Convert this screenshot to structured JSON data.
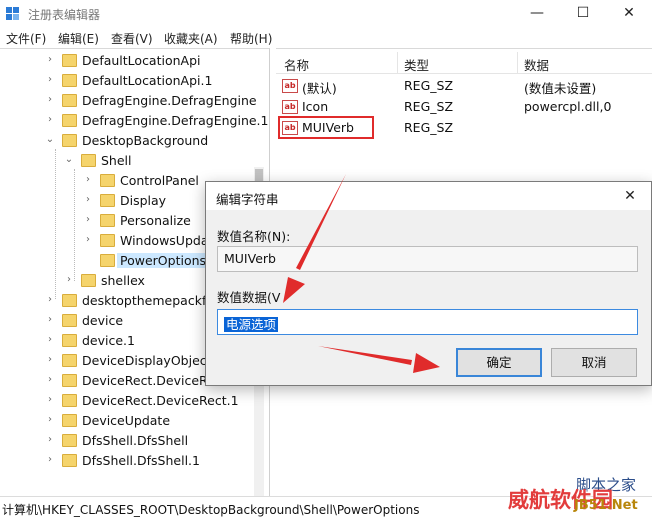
{
  "window": {
    "title": "注册表编辑器",
    "controls": {
      "minimize": "—",
      "maximize": "☐",
      "close": "✕"
    }
  },
  "menu": [
    "文件(F)",
    "编辑(E)",
    "查看(V)",
    "收藏夹(A)",
    "帮助(H)"
  ],
  "tree": {
    "items": [
      {
        "label": "DefaultLocationApi",
        "expander": "›"
      },
      {
        "label": "DefaultLocationApi.1",
        "expander": "›"
      },
      {
        "label": "DefragEngine.DefragEngine",
        "expander": "›"
      },
      {
        "label": "DefragEngine.DefragEngine.1",
        "expander": "›"
      },
      {
        "label": "DesktopBackground",
        "expander": "⌄"
      },
      {
        "label": "Shell",
        "expander": "⌄"
      },
      {
        "label": "ControlPanel",
        "expander": "›"
      },
      {
        "label": "Display",
        "expander": "›"
      },
      {
        "label": "Personalize",
        "expander": "›"
      },
      {
        "label": "WindowsUpda",
        "expander": "›"
      },
      {
        "label": "PowerOptions",
        "expander": ""
      },
      {
        "label": "shellex",
        "expander": "›"
      },
      {
        "label": "desktopthemepackfil",
        "expander": "›"
      },
      {
        "label": "device",
        "expander": "›"
      },
      {
        "label": "device.1",
        "expander": "›"
      },
      {
        "label": "DeviceDisplayObject",
        "expander": "›"
      },
      {
        "label": "DeviceRect.DeviceRec",
        "expander": "›"
      },
      {
        "label": "DeviceRect.DeviceRect.1",
        "expander": "›"
      },
      {
        "label": "DeviceUpdate",
        "expander": "›"
      },
      {
        "label": "DfsShell.DfsShell",
        "expander": "›"
      },
      {
        "label": "DfsShell.DfsShell.1",
        "expander": "›"
      }
    ]
  },
  "list": {
    "columns": [
      "名称",
      "类型",
      "数据"
    ],
    "rows": [
      {
        "icon": "ab",
        "name": "(默认)",
        "type": "REG_SZ",
        "data": "(数值未设置)"
      },
      {
        "icon": "ab",
        "name": "Icon",
        "type": "REG_SZ",
        "data": "powercpl.dll,0"
      },
      {
        "icon": "ab",
        "name": "MUIVerb",
        "type": "REG_SZ",
        "data": ""
      }
    ]
  },
  "status": {
    "path": "计算机\\HKEY_CLASSES_ROOT\\DesktopBackground\\Shell\\PowerOptions"
  },
  "dialog": {
    "title": "编辑字符串",
    "close": "✕",
    "name_label": "数值名称(N):",
    "name_value": "MUIVerb",
    "data_label": "数值数据(V",
    "data_value": "电源选项",
    "ok_label": "确定",
    "cancel_label": "取消"
  },
  "watermark": {
    "line1": "脚本之家",
    "line2": "威航软件园",
    "line3": "JB51.Net"
  },
  "colors": {
    "annotation_red": "#e02b2b",
    "selection_blue": "#0a64d6",
    "folder_yellow": "#f5d46c"
  }
}
